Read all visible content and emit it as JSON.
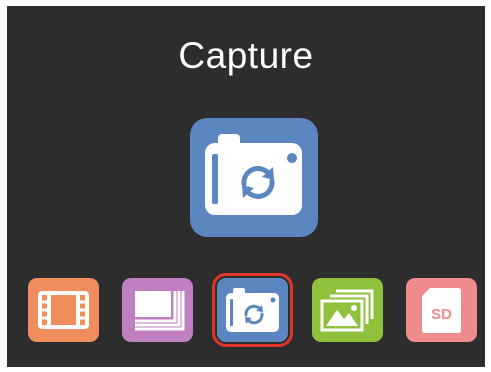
{
  "screen": {
    "title": "Capture",
    "background": "#2d2d2d"
  },
  "main_icon": {
    "icon": "camera-capture-icon",
    "color": "#5b86c0"
  },
  "menu": {
    "selected_index": 2,
    "items": [
      {
        "icon": "film-icon",
        "color": "#ef8e5c"
      },
      {
        "icon": "gallery-icon",
        "color": "#bf7fc0"
      },
      {
        "icon": "camera-capture-icon",
        "color": "#5b86c0"
      },
      {
        "icon": "picture-icon",
        "color": "#8fc13d"
      },
      {
        "icon": "sd-card-icon",
        "color": "#ee8c8d",
        "label": "SD"
      }
    ]
  }
}
